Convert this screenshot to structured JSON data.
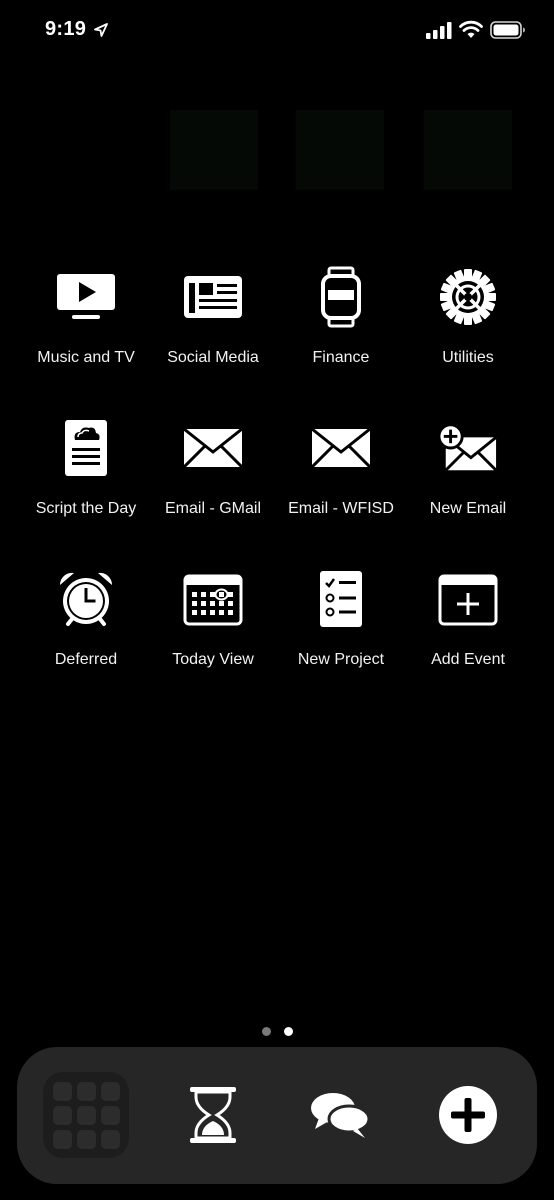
{
  "status_bar": {
    "time": "9:19",
    "icons": [
      "location-arrow-icon",
      "cellular-signal-icon",
      "wifi-icon",
      "battery-icon"
    ]
  },
  "apps": [
    {
      "label": "Music and TV",
      "icon": "tv-play-icon"
    },
    {
      "label": "Social Media",
      "icon": "newspaper-icon"
    },
    {
      "label": "Finance",
      "icon": "smartwatch-icon"
    },
    {
      "label": "Utilities",
      "icon": "gear-icon"
    },
    {
      "label": "Script the Day",
      "icon": "document-cloud-icon"
    },
    {
      "label": "Email - GMail",
      "icon": "envelope-icon"
    },
    {
      "label": "Email - WFISD",
      "icon": "envelope-icon"
    },
    {
      "label": "New Email",
      "icon": "envelope-plus-icon"
    },
    {
      "label": "Deferred",
      "icon": "alarm-clock-icon"
    },
    {
      "label": "Today View",
      "icon": "calendar-icon"
    },
    {
      "label": "New Project",
      "icon": "checklist-icon"
    },
    {
      "label": "Add Event",
      "icon": "calendar-add-icon"
    }
  ],
  "page_indicator": {
    "count": 2,
    "current": 2
  },
  "dock": {
    "items": [
      {
        "icon": "app-folder-icon"
      },
      {
        "icon": "hourglass-icon"
      },
      {
        "icon": "chat-bubbles-icon"
      },
      {
        "icon": "plus-circle-icon"
      }
    ]
  },
  "colors": {
    "background": "#000000",
    "dock": "#262626",
    "icon": "#ffffff",
    "dot_inactive": "#7a7a7a",
    "dot_active": "#ffffff"
  }
}
